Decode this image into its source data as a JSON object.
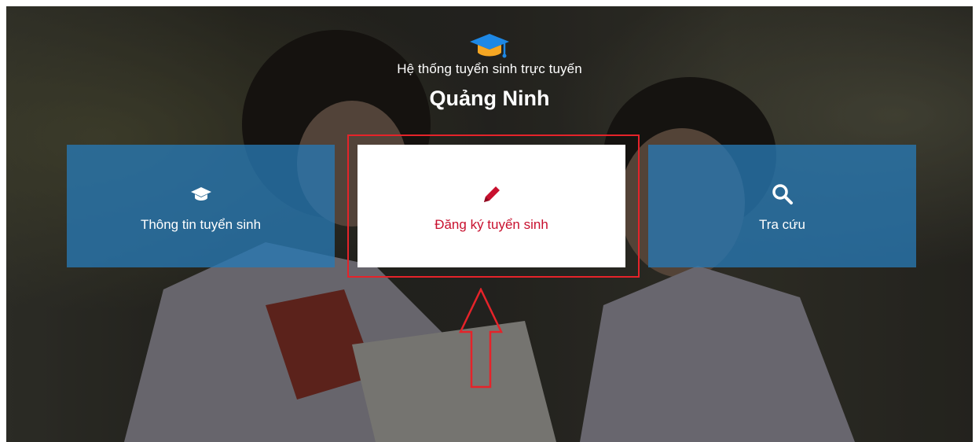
{
  "header": {
    "subtitle": "Hệ thống tuyển sinh trực tuyến",
    "title": "Quảng Ninh",
    "icon": "graduation-cap-icon"
  },
  "tiles": [
    {
      "label": "Thông tin tuyển sinh",
      "icon": "graduation-cap-icon",
      "style": "blue"
    },
    {
      "label": "Đăng ký tuyển sinh",
      "icon": "pencil-icon",
      "style": "white",
      "highlighted": true
    },
    {
      "label": "Tra cứu",
      "icon": "search-icon",
      "style": "blue"
    }
  ],
  "colors": {
    "tile_blue": "#2878B4",
    "accent_red": "#C8102E",
    "annotation_red": "#E5232A",
    "cap_blue": "#1E88E5",
    "cap_orange": "#F5A623"
  }
}
